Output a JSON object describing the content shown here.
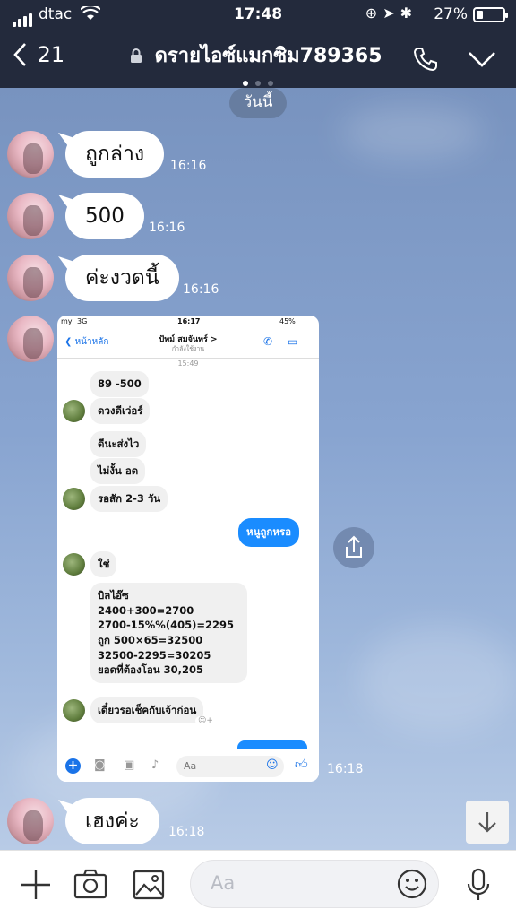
{
  "status_bar": {
    "carrier": "dtac",
    "time": "17:48",
    "battery": "27%"
  },
  "header": {
    "back_count": "21",
    "title": "ดรายไอซ์แมกซิม789365"
  },
  "chat": {
    "date_pill": "วันนี้",
    "messages": [
      {
        "text": "ถูกล่าง",
        "time": "16:16"
      },
      {
        "text": "500",
        "time": "16:16"
      },
      {
        "text": "ค่ะงวดนี้",
        "time": "16:16"
      },
      {
        "text": "เฮงค่ะ",
        "time": "16:18"
      }
    ],
    "image_time": "16:18"
  },
  "screenshot": {
    "carrier": "my",
    "network": "3G",
    "time": "16:17",
    "battery": "45%",
    "back_label": "หน้าหลัก",
    "contact_name": "ปัทม์ สมจันทร์ >",
    "contact_status": "กำลังใช้งาน",
    "chat_time": "15:49",
    "msg1": "89 -500",
    "msg2": "ดวงดีเว่อร์",
    "msg3": "ดีนะส่งไว",
    "msg4": "ไม่งั้น อด",
    "msg5": "รอสัก 2-3 วัน",
    "msg_self": "หนูถูกหรอ",
    "msg6": "ใช่",
    "bill_lines": [
      "บิลไอ๊ซ",
      "2400+300=2700",
      "2700-15%%(405)=2295",
      "ถูก 500×65=32500",
      "32500-2295=30205",
      "ยอดที่ต้องโอน 30,205"
    ],
    "msg7": "เดี๋ยวรอเช็คกับเจ้าก่อน",
    "input_placeholder": "Aa"
  },
  "composer": {
    "placeholder": "Aa"
  }
}
